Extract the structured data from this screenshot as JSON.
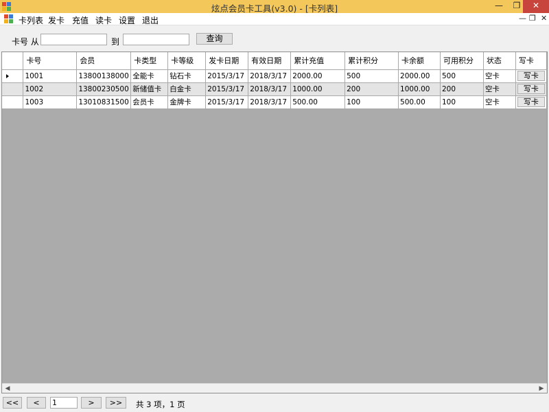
{
  "window": {
    "title": "炫点会员卡工具(v3.0) - [卡列表]"
  },
  "menu": {
    "items": [
      "卡列表",
      "发卡",
      "充值",
      "读卡",
      "设置",
      "退出"
    ]
  },
  "filter": {
    "from_label": "卡号 从",
    "to_label": "到",
    "from_value": "",
    "to_value": "",
    "query_button": "查询"
  },
  "grid": {
    "columns": [
      "卡号",
      "会员",
      "卡类型",
      "卡等级",
      "发卡日期",
      "有效日期",
      "累计充值",
      "累计积分",
      "卡余额",
      "可用积分",
      "状态",
      "写卡"
    ],
    "rows": [
      [
        "1001",
        "13800138000",
        "全能卡",
        "钻石卡",
        "2015/3/17",
        "2018/3/17",
        "2000.00",
        "500",
        "2000.00",
        "500",
        "空卡",
        "写卡"
      ],
      [
        "1002",
        "13800230500",
        "新储值卡",
        "白金卡",
        "2015/3/17",
        "2018/3/17",
        "1000.00",
        "200",
        "1000.00",
        "200",
        "空卡",
        "写卡"
      ],
      [
        "1003",
        "13010831500",
        "会员卡",
        "金牌卡",
        "2015/3/17",
        "2018/3/17",
        "500.00",
        "100",
        "500.00",
        "100",
        "空卡",
        "写卡"
      ]
    ]
  },
  "pager": {
    "first": "<<",
    "prev": "<",
    "page_value": "1",
    "next": ">",
    "last": ">>",
    "summary": "共 3 项，1 页"
  },
  "icons": {
    "close": "✕",
    "maximize": "❐",
    "minimize": "—"
  }
}
